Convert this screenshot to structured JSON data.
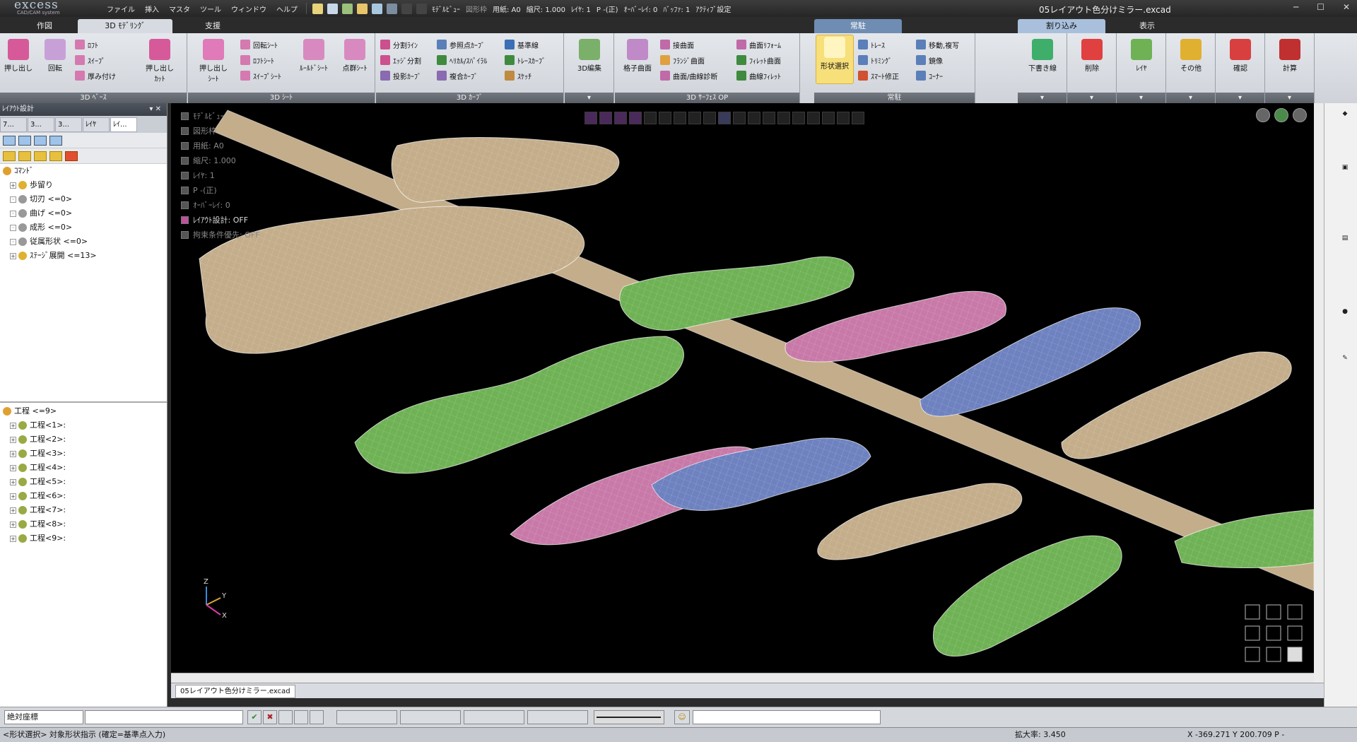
{
  "titlebar": {
    "logo": "excess",
    "logo_sub": "CAD/CAM system",
    "menus": [
      "ファイル",
      "挿入",
      "マスタ",
      "ツール",
      "ウィンドウ",
      "ヘルプ"
    ],
    "quick": {
      "model_view": "ﾓﾃﾞﾙﾋﾞｭｰ",
      "figure_frame": "図形枠",
      "paper": "用紙: A0",
      "scale": "縮尺: 1.000",
      "layer": "ﾚｲﾔ: 1",
      "pen": "P -(正)",
      "overlay": "ｵｰﾊﾞｰﾚｲ: 0",
      "buffer": "ﾊﾞｯﾌｧ: 1",
      "active": "ｱｸﾃｨﾌﾞ設定"
    },
    "document": "05レイアウト色分けミラー.excad"
  },
  "tabs": {
    "draw": "作図",
    "modeling": "3D ﾓﾃﾞﾘﾝｸﾞ",
    "support": "支援",
    "resident": "常駐",
    "nesting": "割り込み",
    "display": "表示"
  },
  "ribbon": {
    "g1": {
      "b1": "押し出し",
      "b2": "回転",
      "s1": "ﾛﾌﾄ",
      "s2": "ｽｲｰﾌﾟ",
      "s3": "厚み付け",
      "b3a": "押し出し",
      "b3b": "ｶｯﾄ",
      "label": "3D ﾍﾞｰｽ"
    },
    "g2": {
      "b1a": "押し出し",
      "b1b": "ｼｰﾄ",
      "s1": "回転ｼｰﾄ",
      "s2": "ﾛﾌﾄｼｰﾄ",
      "s3": "ｽｲｰﾌﾟｼｰﾄ",
      "b2": "ﾙｰﾙﾄﾞｼｰﾄ",
      "b3": "点群ｼｰﾄ",
      "label": "3D ｼｰﾄ"
    },
    "g3": {
      "s1": "分割ﾗｲﾝ",
      "s2": "ｴｯｼﾞ分割",
      "s3": "投影ｶｰﾌﾞ",
      "s4": "参照点ｶｰﾌﾞ",
      "s5": "ﾍﾘｶﾙ/ｽﾊﾟｲﾗﾙ",
      "s6": "複合ｶｰﾌﾞ",
      "s7": "基準線",
      "s8": "ﾄﾚｰｽｶｰﾌﾞ",
      "s9": "ｽｹｯﾁ",
      "label": "3D ｶｰﾌﾞ"
    },
    "g4": {
      "b1": "3D編集"
    },
    "g5": {
      "b1": "格子曲面",
      "s1": "接曲面",
      "s2": "ﾌﾗﾝｼﾞ曲面",
      "s3": "曲面/曲線診断",
      "s4": "曲面ﾘﾌｫｰﾑ",
      "s5": "ﾌｨﾚｯﾄ曲面",
      "s6": "曲線ﾌｨﾚｯﾄ",
      "label": "3D ｻｰﾌｪｽ OP"
    },
    "g6": {
      "b1": "形状選択",
      "s1": "ﾄﾚｰｽ",
      "s2": "ﾄﾘﾐﾝｸﾞ",
      "s3": "ｽﾏｰﾄ修正",
      "s4": "移動,複写",
      "s5": "鏡像",
      "s6": "ｺｰﾅｰ",
      "label": "常駐"
    },
    "g7": {
      "b1": "下書き線",
      "b2": "削除",
      "b3": "ﾚｲﾔ",
      "b4": "その他",
      "b5": "確認",
      "b6": "計算"
    }
  },
  "left_panel": {
    "title": "ﾚｲｱｳﾄ設計",
    "tabs": [
      "7...",
      "3...",
      "3...",
      "ﾚｲﾔ",
      "ﾚｲ..."
    ],
    "tree1": [
      "ｺﾏﾝﾄﾞ",
      "歩留り",
      "切刃 <=0>",
      "曲げ <=0>",
      "成形 <=0>",
      "従属形状 <=0>",
      "ｽﾃｰｼﾞ展開 <=13>"
    ],
    "tree2": [
      "工程 <=9>",
      "工程<1>:",
      "工程<2>:",
      "工程<3>:",
      "工程<4>:",
      "工程<5>:",
      "工程<6>:",
      "工程<7>:",
      "工程<8>:",
      "工程<9>:"
    ]
  },
  "viewport": {
    "info": [
      "ﾓﾃﾞﾙﾋﾞｭｰ",
      "図形枠",
      "用紙: A0",
      "縮尺: 1.000",
      "ﾚｲﾔ: 1",
      "P -(正)",
      "ｵｰﾊﾞｰﾚｲ: 0",
      "ﾚｲｱｳﾄ設計: OFF",
      "拘束条件優先: OFF"
    ],
    "axes": {
      "z": "Z",
      "y": "Y",
      "x": "X"
    },
    "colors": {
      "tan": "#c4ad8a",
      "green": "#6fb255",
      "pink": "#c879a8",
      "blue": "#6e82c0"
    }
  },
  "doc_tab": "05レイアウト色分けミラー.excad",
  "cmd": {
    "coord": "絶対座標"
  },
  "status": {
    "message": "<形状選択> 対象形状指示 (確定=基準点入力)",
    "zoom": "拡大率: 3.450",
    "cursor": "X -369.271 Y 200.709  P -"
  }
}
